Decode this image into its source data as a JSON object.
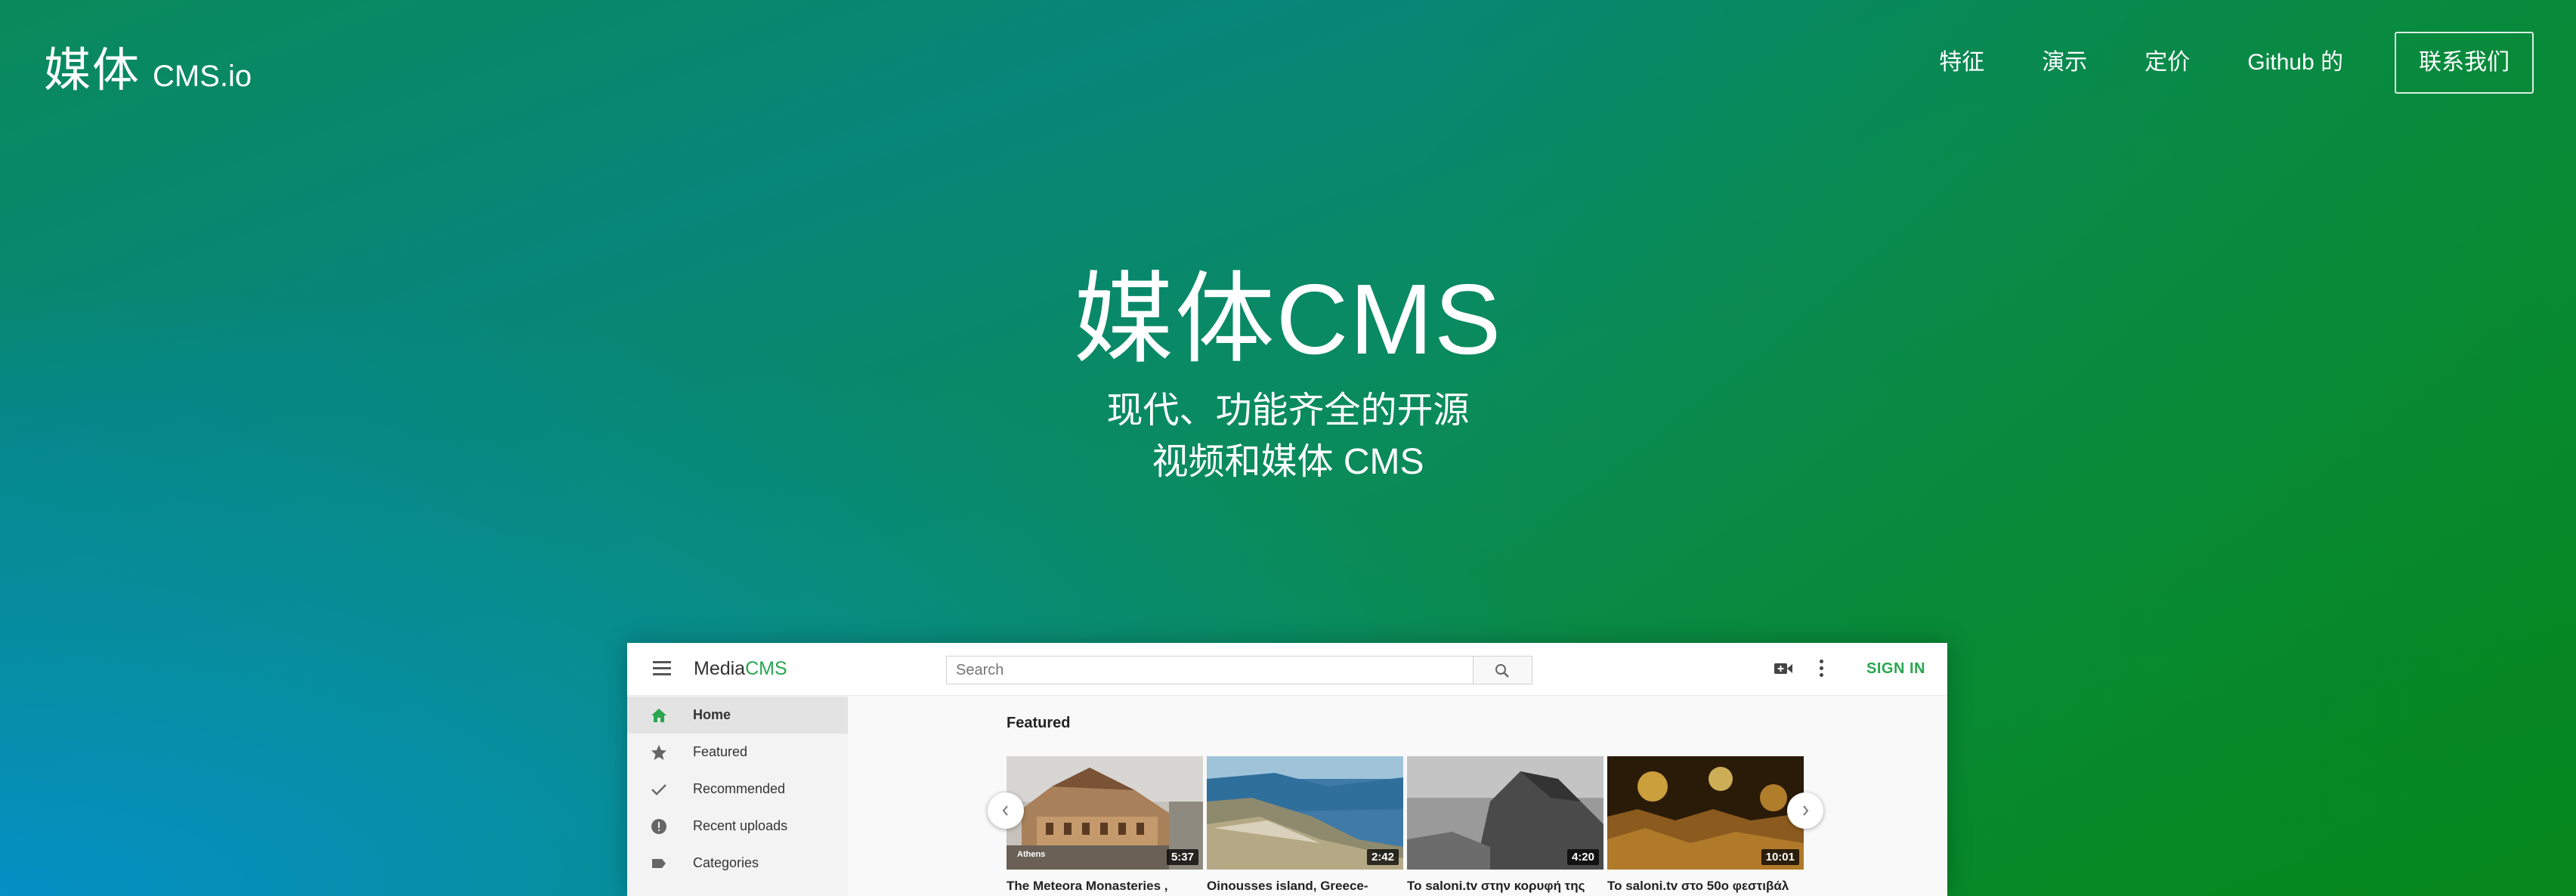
{
  "brand": {
    "logo_cn": "媒体",
    "logo_en": "CMS.io"
  },
  "nav": {
    "links": [
      "特征",
      "演示",
      "定价",
      "Github 的"
    ],
    "contact": "联系我们"
  },
  "hero": {
    "title_cn": "媒体",
    "title_en": "CMS",
    "subtitle_line1": "现代、功能齐全的开源",
    "subtitle_line2": "视频和媒体 CMS"
  },
  "app": {
    "logo_media": "Media",
    "logo_cms": "CMS",
    "search_placeholder": "Search",
    "signin": "SIGN IN",
    "sidebar": [
      {
        "label": "Home",
        "icon": "home-icon",
        "active": true
      },
      {
        "label": "Featured",
        "icon": "star-icon",
        "active": false
      },
      {
        "label": "Recommended",
        "icon": "check-icon",
        "active": false
      },
      {
        "label": "Recent uploads",
        "icon": "badge-icon",
        "active": false
      },
      {
        "label": "Categories",
        "icon": "label-icon",
        "active": false
      }
    ],
    "featured_title": "Featured",
    "videos": [
      {
        "duration": "5:37",
        "title": "The Meteora Monasteries ,",
        "overlay": "Athens"
      },
      {
        "duration": "2:42",
        "title": "Oinousses island, Greece-"
      },
      {
        "duration": "4:20",
        "title": "To saloni.tv στην κορυφή της"
      },
      {
        "duration": "10:01",
        "title": "To saloni.tv στο 50ο φεστιβάλ"
      }
    ]
  },
  "colors": {
    "accent_green": "#2aa650",
    "gradient_blue": "#0590c6",
    "gradient_green": "#07891c"
  }
}
